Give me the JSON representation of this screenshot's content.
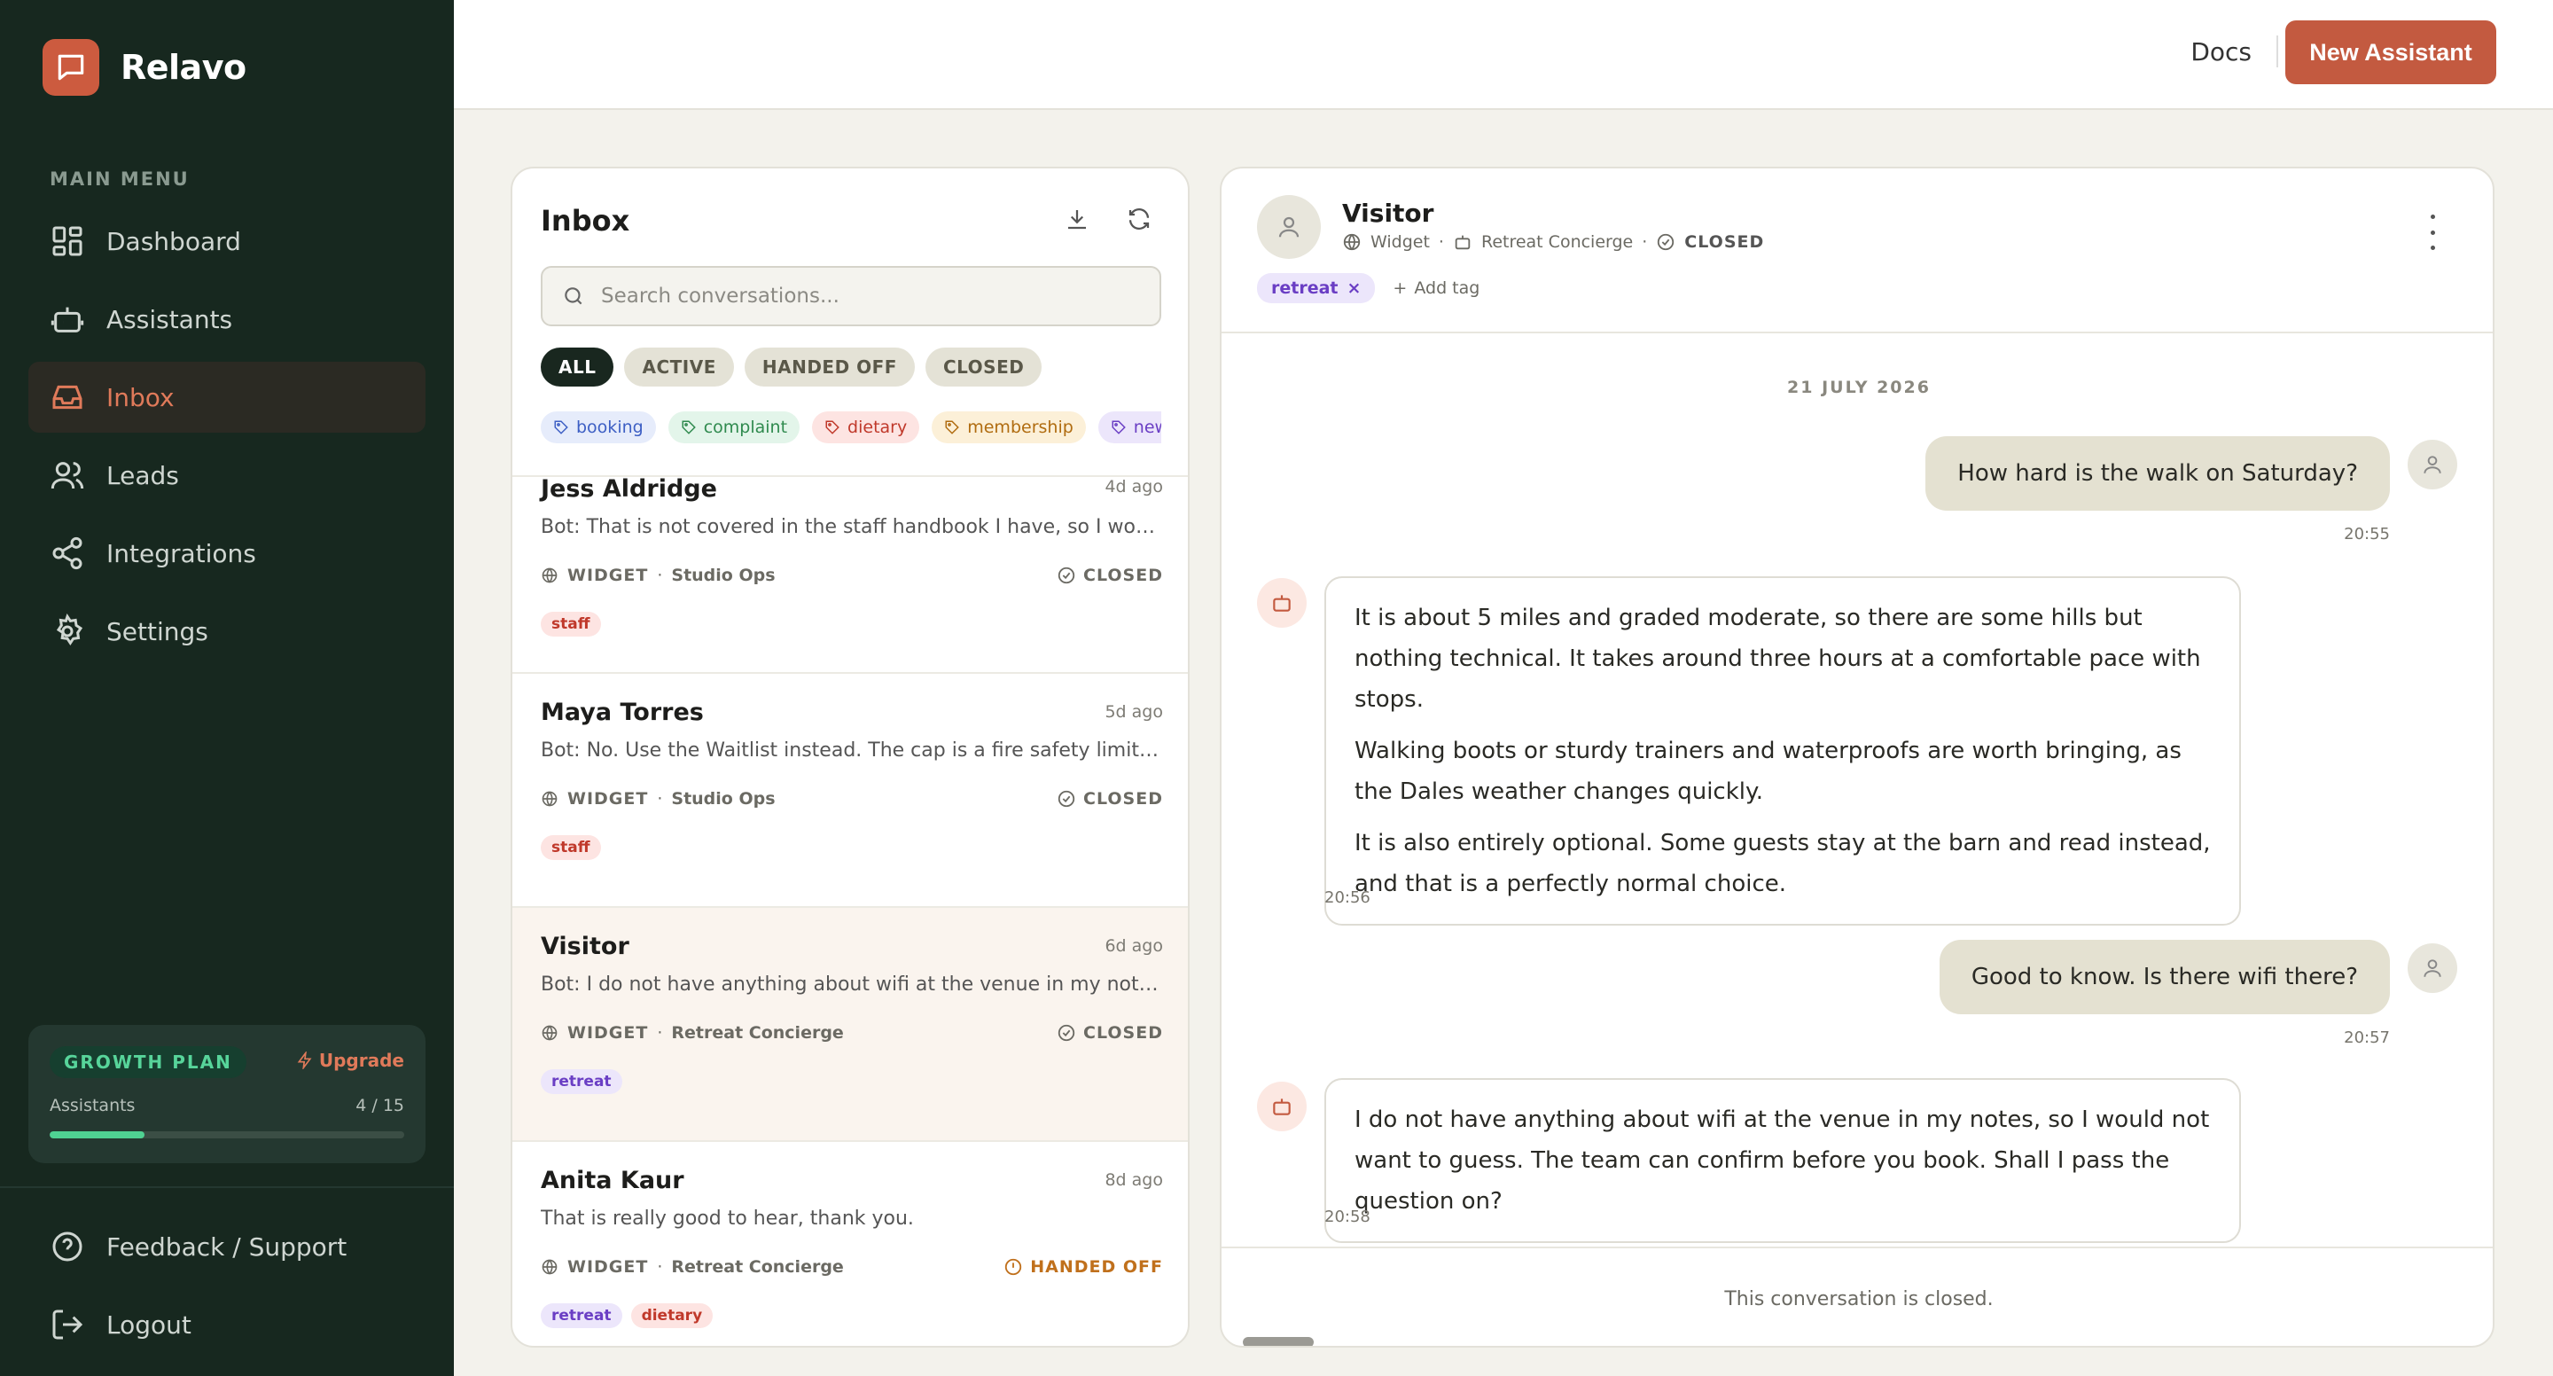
{
  "brand": {
    "name": "Relavo"
  },
  "sidebar": {
    "menu_title": "MAIN MENU",
    "items": [
      {
        "label": "Dashboard",
        "icon": "grid-icon"
      },
      {
        "label": "Assistants",
        "icon": "robot-icon"
      },
      {
        "label": "Inbox",
        "icon": "inbox-icon"
      },
      {
        "label": "Leads",
        "icon": "users-icon"
      },
      {
        "label": "Integrations",
        "icon": "share-icon"
      },
      {
        "label": "Settings",
        "icon": "gear-icon"
      }
    ],
    "active_item": "Inbox",
    "plan": {
      "name": "GROWTH PLAN",
      "upgrade": "Upgrade",
      "assistants_label": "Assistants",
      "assistants_count": "4 / 15",
      "usage_fraction": 0.2667
    },
    "bottom": [
      {
        "label": "Feedback / Support",
        "icon": "help-circle-icon"
      },
      {
        "label": "Logout",
        "icon": "logout-icon"
      }
    ]
  },
  "topbar": {
    "docs": "Docs",
    "new_assistant": "New Assistant"
  },
  "inbox": {
    "title": "Inbox",
    "search_placeholder": "Search conversations...",
    "filters": [
      "ALL",
      "ACTIVE",
      "HANDED OFF",
      "CLOSED"
    ],
    "active_filter": "ALL",
    "tags": [
      {
        "label": "booking",
        "bg": "#e6ecfb",
        "fg": "#3d5fc4"
      },
      {
        "label": "complaint",
        "bg": "#e3f5ea",
        "fg": "#2f8a4e"
      },
      {
        "label": "dietary",
        "bg": "#fde4e2",
        "fg": "#c0392b"
      },
      {
        "label": "membership",
        "bg": "#fcf0d8",
        "fg": "#b06c10"
      },
      {
        "label": "new",
        "bg": "#ece6fb",
        "fg": "#6a3ec4"
      }
    ],
    "conversations": [
      {
        "name": "Jess Aldridge",
        "time": "4d ago",
        "preview": "Bot: That is not covered in the staff handbook I have, so I would r...",
        "channel": "WIDGET",
        "assistant": "Studio Ops",
        "status": "CLOSED",
        "tags": [
          "staff"
        ]
      },
      {
        "name": "Maya Torres",
        "time": "5d ago",
        "preview": "Bot: No. Use the Waitlist instead. The cap is a fire safety limit rat...",
        "channel": "WIDGET",
        "assistant": "Studio Ops",
        "status": "CLOSED",
        "tags": [
          "staff"
        ]
      },
      {
        "name": "Visitor",
        "time": "6d ago",
        "preview": "Bot: I do not have anything about wifi at the venue in my notes, s...",
        "channel": "WIDGET",
        "assistant": "Retreat Concierge",
        "status": "CLOSED",
        "tags": [
          "retreat"
        ]
      },
      {
        "name": "Anita Kaur",
        "time": "8d ago",
        "preview": "That is really good to hear, thank you.",
        "channel": "WIDGET",
        "assistant": "Retreat Concierge",
        "status": "HANDED OFF",
        "tags": [
          "retreat",
          "dietary"
        ]
      }
    ]
  },
  "chat": {
    "name": "Visitor",
    "channel": "Widget",
    "assistant": "Retreat Concierge",
    "status": "CLOSED",
    "tag": "retreat",
    "add_tag": "Add tag",
    "date": "21 JULY 2026",
    "messages": [
      {
        "from": "user",
        "text": "How hard is the walk on Saturday?",
        "time": "20:55"
      },
      {
        "from": "bot",
        "paragraphs": [
          "It is about 5 miles and graded moderate, so there are some hills but nothing technical. It takes around three hours at a comfortable pace with stops.",
          "Walking boots or sturdy trainers and waterproofs are worth bringing, as the Dales weather changes quickly.",
          "It is also entirely optional. Some guests stay at the barn and read instead, and that is a perfectly normal choice."
        ],
        "time": "20:56"
      },
      {
        "from": "user",
        "text": "Good to know. Is there wifi there?",
        "time": "20:57"
      },
      {
        "from": "bot",
        "paragraphs": [
          "I do not have anything about wifi at the venue in my notes, so I would not want to guess. The team can confirm before you book. Shall I pass the question on?"
        ],
        "time": "20:58"
      }
    ],
    "footer": "This conversation is closed."
  },
  "colors": {
    "accent": "#c35a40",
    "sidebar_bg": "#17281f",
    "active_nav": "#e07a5a",
    "plan_green": "#4fd192"
  }
}
